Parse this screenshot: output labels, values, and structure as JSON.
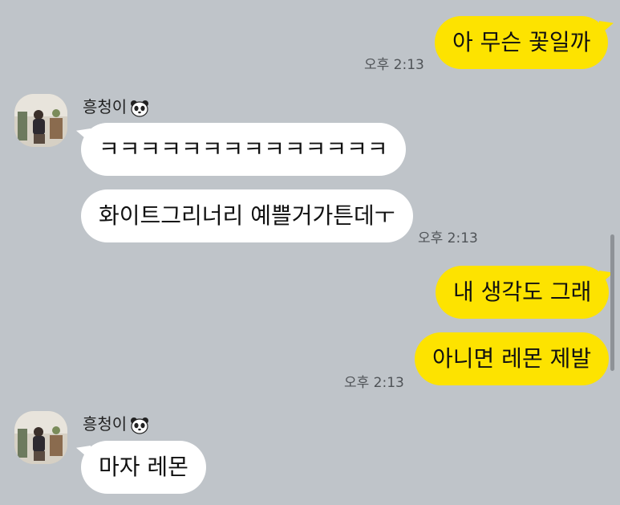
{
  "chat": {
    "messages": [
      {
        "id": "m1",
        "direction": "outgoing",
        "text": "아 무슨 꽃일까",
        "time": "오후 2:13"
      },
      {
        "id": "m2",
        "direction": "incoming",
        "sender": "흥청이",
        "text": "ㅋㅋㅋㅋㅋㅋㅋㅋㅋㅋㅋㅋㅋㅋ"
      },
      {
        "id": "m3",
        "direction": "incoming",
        "sender": "흥청이",
        "text": "화이트그리너리 예쁠거가튼데ㅜ",
        "time": "오후 2:13"
      },
      {
        "id": "m4",
        "direction": "outgoing",
        "text": "내 생각도 그래"
      },
      {
        "id": "m5",
        "direction": "outgoing",
        "text": "아니면 레몬 제발",
        "time": "오후 2:13"
      },
      {
        "id": "m6",
        "direction": "incoming",
        "sender": "흥청이",
        "text": "마자 레몬"
      }
    ],
    "sender_groups": [
      {
        "name": "흥청이",
        "emoji_icon": "panda-face-icon"
      },
      {
        "name": "흥청이",
        "emoji_icon": "panda-face-icon"
      }
    ]
  },
  "colors": {
    "background": "#bfc4c9",
    "outgoing_bubble": "#fde300",
    "incoming_bubble": "#ffffff",
    "timestamp": "#4f5357"
  }
}
